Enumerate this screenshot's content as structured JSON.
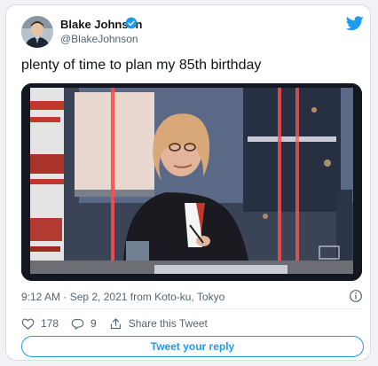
{
  "tweet": {
    "author_name": "Blake Johnson",
    "author_handle": "@BlakeJohnson",
    "text": "plenty of time to plan my 85th birthday",
    "timestamp": "9:12 AM · Sep 2, 2021 from Koto-ku, Tokyo",
    "likes": "178",
    "replies": "9",
    "share_label": "Share this Tweet",
    "reply_button": "Tweet your reply"
  },
  "colors": {
    "brand": "#1d9bf0",
    "text": "#0f1419",
    "muted": "#536471"
  },
  "icons": [
    "verified-badge-icon",
    "twitter-bird-icon",
    "info-icon",
    "heart-icon",
    "reply-icon",
    "share-icon"
  ]
}
